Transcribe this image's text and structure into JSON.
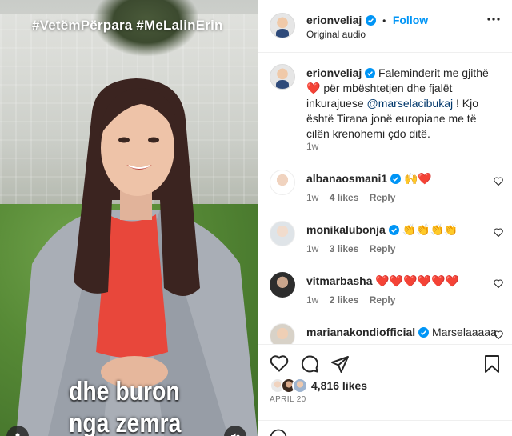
{
  "video": {
    "hashtag": "#VetëmPërpara #MeLalinErin",
    "subtitle_line1": "dhe buron",
    "subtitle_line2": "nga zemra"
  },
  "header": {
    "username": "erionveliaj",
    "separator": "•",
    "follow_label": "Follow",
    "audio": "Original audio"
  },
  "caption": {
    "username": "erionveliaj",
    "text_part1": " Faleminderit me gjithë ",
    "emoji": "❤️",
    "text_part2": " për mbështetjen dhe fjalët inkurajuese ",
    "mention": "@marselacibukaj",
    "text_part3": " ! Kjo është Tirana jonë europiane me të cilën krenohemi çdo ditë.",
    "time": "1w"
  },
  "comments": [
    {
      "username": "albanaosmani1",
      "text": "🙌❤️",
      "time": "1w",
      "likes": "4 likes",
      "reply": "Reply"
    },
    {
      "username": "monikalubonja",
      "text": "👏👏👏👏",
      "time": "1w",
      "likes": "3 likes",
      "reply": "Reply"
    },
    {
      "username": "vitmarbasha",
      "text": "❤️❤️❤️❤️❤️❤️",
      "time": "1w",
      "likes": "2 likes",
      "reply": "Reply"
    },
    {
      "username": "marianakondiofficial",
      "text": "Marselaaaaa",
      "time": "",
      "likes": "",
      "reply": ""
    }
  ],
  "footer": {
    "likes": "4,816 likes",
    "date": "APRIL 20"
  },
  "colors": {
    "accent": "#0095f6",
    "mention": "#00376b",
    "heart": "#ed4956"
  }
}
